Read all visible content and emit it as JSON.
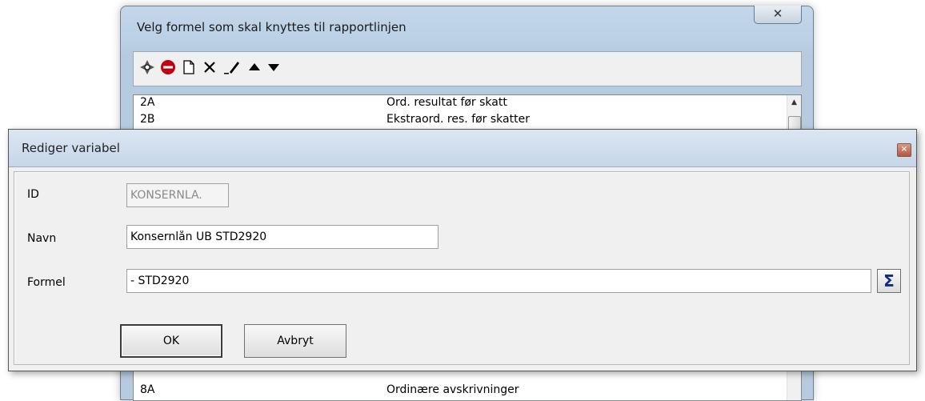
{
  "back_window": {
    "title": "Velg formel som skal knyttes til rapportlinjen",
    "close_glyph": "✕",
    "toolbar_icons": [
      "crosshair-icon",
      "stop-icon",
      "new-document-icon",
      "delete-icon",
      "edit-pencil-icon",
      "move-up-icon",
      "move-down-icon"
    ],
    "list_rows": [
      {
        "code": "2A",
        "desc": "Ord. resultat før skatt"
      },
      {
        "code": "2B",
        "desc": "Ekstraord. res. før skatter"
      },
      {
        "code": "8A",
        "desc": "Ordinære avskrivninger"
      }
    ]
  },
  "dialog": {
    "title": "Rediger variabel",
    "id_label": "ID",
    "id_value": "KONSERNLA.",
    "name_label": "Navn",
    "name_value": "Konsernlån UB STD2920",
    "formula_label": "Formel",
    "formula_value": "- STD2920",
    "sigma_glyph": "Σ",
    "ok_label": "OK",
    "cancel_label": "Avbryt"
  },
  "colors": {
    "titlebar": "#c6d6e8",
    "dialog_bg": "#f0f0f0",
    "close_red": "#b8553d",
    "sigma_blue": "#0c2b8a"
  }
}
